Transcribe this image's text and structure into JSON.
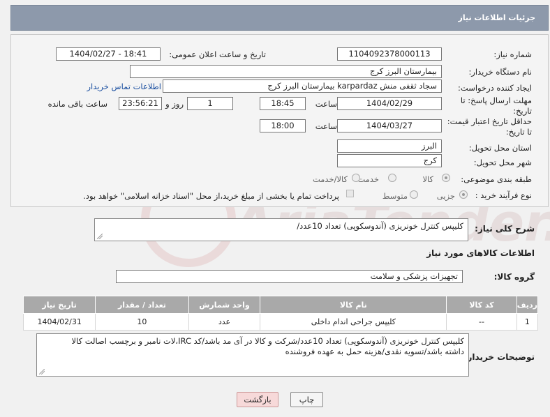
{
  "header": {
    "title": "جزئیات اطلاعات نیاز"
  },
  "form": {
    "need_number_label": "شماره نیاز:",
    "need_number": "1104092378000113",
    "announce_label": "تاریخ و ساعت اعلان عمومی:",
    "announce_value": "1404/02/27 - 18:41",
    "buyer_org_label": "نام دستگاه خریدار:",
    "buyer_org": "بیمارستان البرز کرج",
    "creator_label": "ایجاد کننده درخواست:",
    "creator": "سجاد ثقفی منش karpardaz بیمارستان البرز کرج",
    "contact_link": "اطلاعات تماس خریدار",
    "deadline_label_1": "مهلت ارسال پاسخ: تا",
    "deadline_label_2": "تاریخ:",
    "deadline_date": "1404/02/29",
    "time_label": "ساعت",
    "deadline_time": "18:45",
    "days_value": "1",
    "days_label": "روز و",
    "remaining_value": "23:56:21",
    "remaining_label": "ساعت باقی مانده",
    "validity_label_1": "حداقل تاریخ اعتبار قیمت:",
    "validity_label_2": "تا تاریخ:",
    "validity_date": "1404/03/27",
    "validity_time": "18:00",
    "province_label": "استان محل تحویل:",
    "province": "البرز",
    "city_label": "شهر محل تحویل:",
    "city": "کرج",
    "category_label": "طبقه بندی موضوعی:",
    "category_options": [
      "کالا",
      "خدمت",
      "کالا/خدمت"
    ],
    "category_selected": "کالا",
    "process_label": "نوع فرآیند خرید :",
    "process_options": [
      "جزیی",
      "متوسط"
    ],
    "process_selected": "جزیی",
    "payment_note": "پرداخت تمام یا بخشی از مبلغ خرید،از محل \"اسناد خزانه اسلامی\" خواهد بود."
  },
  "description": {
    "label": "شرح کلی نیاز:",
    "value": "کلیپس کنترل خونریزی (آندوسکوپی) تعداد 10عدد/"
  },
  "items_section": {
    "title": "اطلاعات کالاهای مورد نیاز",
    "group_label": "گروه کالا:",
    "group_value": "تجهیزات پزشکی و سلامت"
  },
  "table": {
    "headers": [
      "ردیف",
      "کد کالا",
      "نام کالا",
      "واحد شمارش",
      "تعداد / مقدار",
      "تاریخ نیاز"
    ],
    "rows": [
      [
        "1",
        "--",
        "کلیپس جراحی اندام داخلی",
        "عدد",
        "10",
        "1404/02/31"
      ]
    ]
  },
  "buyer_notes": {
    "label": "توضیحات خریدار:",
    "line1": "کلیپس کنترل خونریزی (آندوسکوپی) تعداد 10عدد/شرکت و کالا در آی مد باشد/کد IRC،لات نامبر و برچسب اصالت کالا",
    "line2": "داشته باشد/تسویه نقدی/هزینه حمل به عهده فروشنده"
  },
  "buttons": {
    "print": "چاپ",
    "back": "بازگشت"
  },
  "watermark": {
    "text": "AriaTender.neT"
  },
  "colors": {
    "header_bg": "#8d99ab",
    "table_header_bg": "#a9a9a9",
    "back_button_bg": "#f7d9d9",
    "link": "#1a4fa0"
  }
}
